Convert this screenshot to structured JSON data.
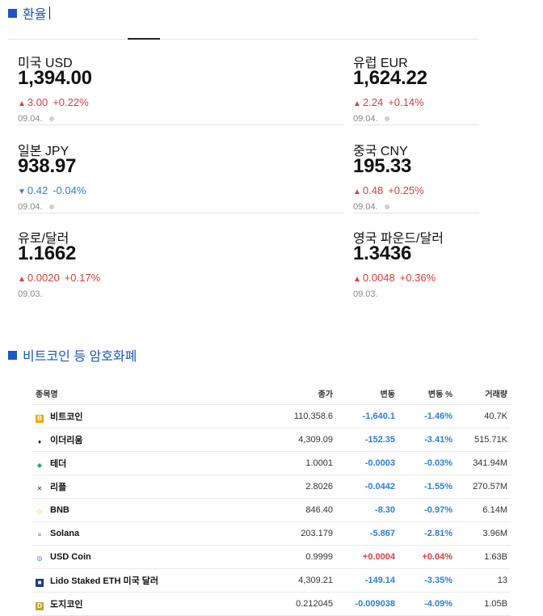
{
  "fx_section": {
    "title": "환율"
  },
  "fx": [
    {
      "name": "미국 USD",
      "value": "1,394.00",
      "dir": "up",
      "arrow": "▲",
      "change": "3.00",
      "pct": "+0.22%",
      "date": "09.04."
    },
    {
      "name": "유럽 EUR",
      "value": "1,624.22",
      "dir": "up",
      "arrow": "▲",
      "change": "2.24",
      "pct": "+0.14%",
      "date": "09.04."
    },
    {
      "name": "일본 JPY",
      "value": "938.97",
      "dir": "down",
      "arrow": "▼",
      "change": "0.42",
      "pct": "-0.04%",
      "date": "09.04."
    },
    {
      "name": "중국 CNY",
      "value": "195.33",
      "dir": "up",
      "arrow": "▲",
      "change": "0.48",
      "pct": "+0.25%",
      "date": "09.04."
    },
    {
      "name": "유로/달러",
      "value": "1.1662",
      "dir": "up",
      "arrow": "▲",
      "change": "0.0020",
      "pct": "+0.17%",
      "date": "09.03."
    },
    {
      "name": "영국 파운드/달러",
      "value": "1.3436",
      "dir": "up",
      "arrow": "▲",
      "change": "0.0048",
      "pct": "+0.36%",
      "date": "09.03."
    }
  ],
  "crypto_section": {
    "title": "비트코인 등 암호화폐"
  },
  "crypto_table": {
    "headers": [
      "종목명",
      "종가",
      "변동",
      "변동 %",
      "거래량"
    ],
    "rows": [
      {
        "name": "비트코인",
        "icon": "bitcoin-icon",
        "icon_color": "#f2a900",
        "glyph": "B",
        "price": "110,358.6",
        "change": "-1,640.1",
        "pct": "-1.46%",
        "volume": "40.7K",
        "dir": "neg"
      },
      {
        "name": "이더리움",
        "icon": "ethereum-icon",
        "icon_color": "#222222",
        "glyph": "♦",
        "price": "4,309.09",
        "change": "-152.35",
        "pct": "-3.41%",
        "volume": "515.71K",
        "dir": "neg"
      },
      {
        "name": "테더",
        "icon": "tether-icon",
        "icon_color": "#26a17b",
        "glyph": "◆",
        "price": "1.0001",
        "change": "-0.0003",
        "pct": "-0.03%",
        "volume": "341.94M",
        "dir": "neg"
      },
      {
        "name": "리플",
        "icon": "xrp-icon",
        "icon_color": "#333333",
        "glyph": "✕",
        "price": "2.8026",
        "change": "-0.0442",
        "pct": "-1.55%",
        "volume": "270.57M",
        "dir": "neg"
      },
      {
        "name": "BNB",
        "icon": "bnb-icon",
        "icon_color": "#f0b90b",
        "glyph": "◇",
        "price": "846.40",
        "change": "-8.30",
        "pct": "-0.97%",
        "volume": "6.14M",
        "dir": "neg"
      },
      {
        "name": "Solana",
        "icon": "solana-icon",
        "icon_color": "#5a6be0",
        "glyph": "≡",
        "price": "203.179",
        "change": "-5.867",
        "pct": "-2.81%",
        "volume": "3.96M",
        "dir": "neg"
      },
      {
        "name": "USD Coin",
        "icon": "usdcoin-icon",
        "icon_color": "#2775ca",
        "glyph": "◎",
        "price": "0.9999",
        "change": "+0.0004",
        "pct": "+0.04%",
        "volume": "1.63B",
        "dir": "pos"
      },
      {
        "name": "Lido Staked ETH 미국 달러",
        "icon": "lido-icon",
        "icon_color": "#1e3a8a",
        "glyph": "■",
        "price": "4,309.21",
        "change": "-149.14",
        "pct": "-3.35%",
        "volume": "13",
        "dir": "neg"
      },
      {
        "name": "도지코인",
        "icon": "dogecoin-icon",
        "icon_color": "#c2a633",
        "glyph": "D",
        "price": "0.212045",
        "change": "-0.009038",
        "pct": "-4.09%",
        "volume": "1.05B",
        "dir": "neg"
      }
    ]
  }
}
